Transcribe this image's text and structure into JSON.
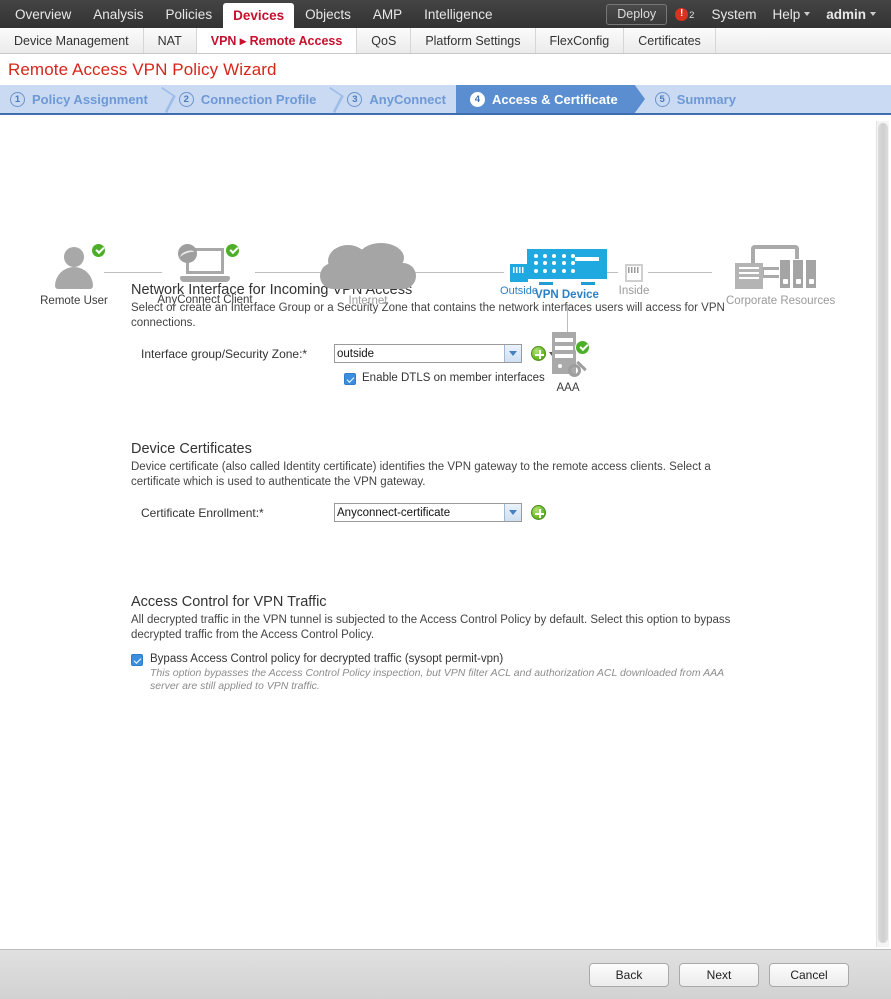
{
  "topnav": {
    "items": [
      {
        "label": "Overview",
        "active": false
      },
      {
        "label": "Analysis",
        "active": false
      },
      {
        "label": "Policies",
        "active": false
      },
      {
        "label": "Devices",
        "active": true
      },
      {
        "label": "Objects",
        "active": false
      },
      {
        "label": "AMP",
        "active": false
      },
      {
        "label": "Intelligence",
        "active": false
      }
    ],
    "deploy_label": "Deploy",
    "alert_count": "2",
    "system_label": "System",
    "help_label": "Help",
    "user_label": "admin"
  },
  "subtabs": [
    {
      "label": "Device Management",
      "active": false
    },
    {
      "label": "NAT",
      "active": false
    },
    {
      "label": "VPN ▸ Remote Access",
      "active": true
    },
    {
      "label": "QoS",
      "active": false
    },
    {
      "label": "Platform Settings",
      "active": false
    },
    {
      "label": "FlexConfig",
      "active": false
    },
    {
      "label": "Certificates",
      "active": false
    }
  ],
  "wizard": {
    "title": "Remote Access VPN Policy Wizard",
    "steps": [
      {
        "num": "1",
        "label": "Policy Assignment",
        "active": false
      },
      {
        "num": "2",
        "label": "Connection Profile",
        "active": false
      },
      {
        "num": "3",
        "label": "AnyConnect",
        "active": false
      },
      {
        "num": "4",
        "label": "Access & Certificate",
        "active": true
      },
      {
        "num": "5",
        "label": "Summary",
        "active": false
      }
    ]
  },
  "topology": {
    "remote_user": "Remote User",
    "anyconnect_client": "AnyConnect Client",
    "internet": "Internet",
    "outside": "Outside",
    "vpn_device": "VPN Device",
    "inside": "Inside",
    "corporate_resources": "Corporate Resources",
    "aaa": "AAA",
    "accent_blue": "#20a8e0",
    "check_green": "#4caf27",
    "gray": "#a8a8a8"
  },
  "network_interface": {
    "title": "Network Interface for Incoming VPN Access",
    "description": "Select or create an Interface Group or a Security Zone that contains the network interfaces users will access for VPN connections.",
    "field_label": "Interface group/Security Zone:*",
    "selected": "outside",
    "options": [
      "outside"
    ],
    "dtls_label": "Enable DTLS on member interfaces",
    "dtls_checked": true
  },
  "device_certificates": {
    "title": "Device Certificates",
    "description": "Device certificate (also called Identity certificate) identifies the VPN gateway to the remote access clients. Select a certificate which is used to authenticate the VPN gateway.",
    "field_label": "Certificate Enrollment:*",
    "selected": "Anyconnect-certificate",
    "options": [
      "Anyconnect-certificate"
    ]
  },
  "access_control": {
    "title": "Access Control for VPN Traffic",
    "description": "All decrypted traffic in the VPN tunnel is subjected to the Access Control Policy by default. Select this option to bypass decrypted traffic from the Access Control Policy.",
    "bypass_label": "Bypass Access Control policy for decrypted traffic (sysopt permit-vpn)",
    "bypass_checked": true,
    "bypass_note": "This option bypasses the Access Control Policy inspection, but VPN filter ACL and authorization ACL downloaded from AAA server are still applied to VPN traffic."
  },
  "footer": {
    "back_label": "Back",
    "next_label": "Next",
    "cancel_label": "Cancel"
  }
}
